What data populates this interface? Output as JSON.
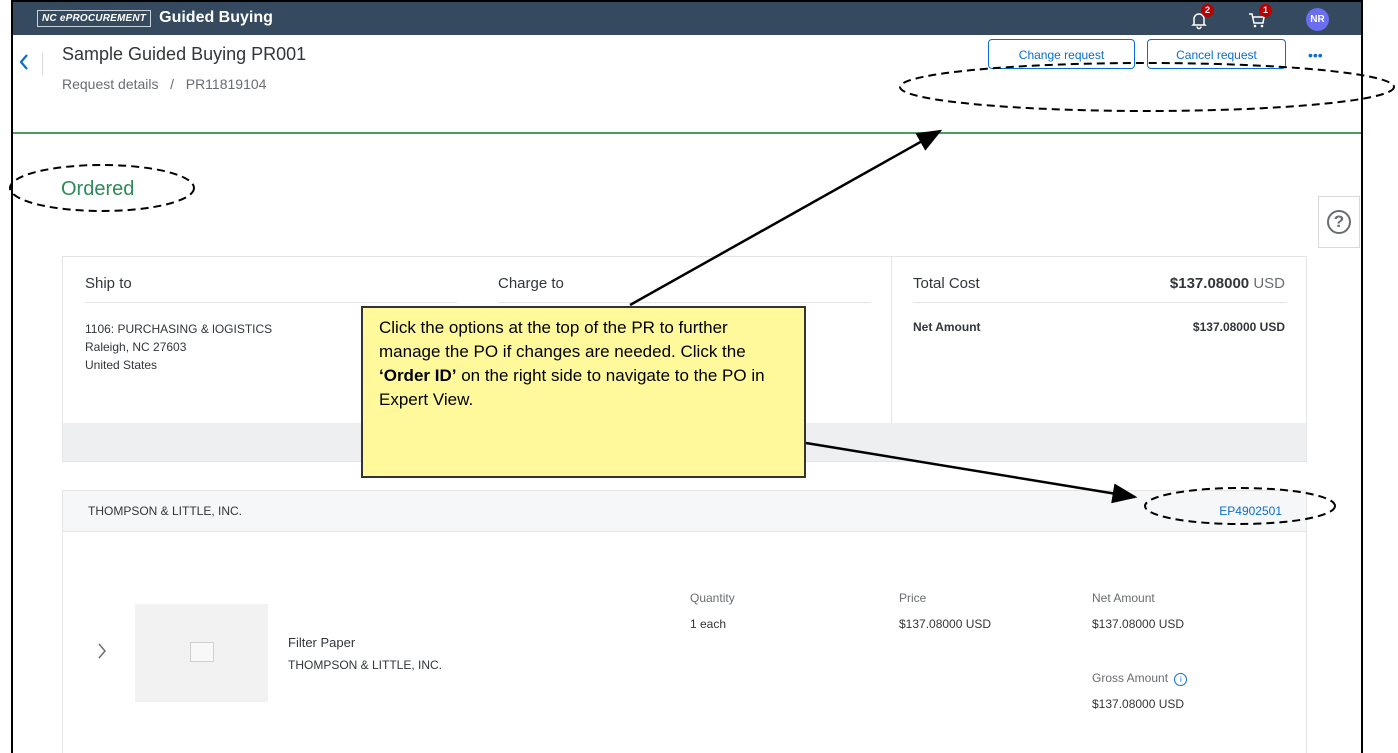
{
  "topbar": {
    "brand_box": "NC ePROCUREMENT",
    "brand_title": "Guided Buying",
    "notifications_count": "2",
    "cart_count": "1",
    "user_initials": "NR"
  },
  "header": {
    "title": "Sample Guided Buying PR001",
    "breadcrumb": "Request details   /   PR11819104",
    "buttons": {
      "change": "Change request",
      "cancel": "Cancel request",
      "more": "•••"
    }
  },
  "status": "Ordered",
  "summary": {
    "ship_to_label": "Ship to",
    "charge_to_label": "Charge to",
    "address_line1": "1106: PURCHASING & lOGISTICS",
    "address_line2": "Raleigh, NC  27603",
    "address_line3": "United States",
    "total_cost_label": "Total Cost",
    "total_cost_value": "$137.08000",
    "total_cost_currency": " USD",
    "net_amount_label": "Net Amount",
    "net_amount_value": "$137.08000 USD"
  },
  "vendor": {
    "name": "THOMPSON & LITTLE, INC.",
    "order_id": "EP4902501"
  },
  "line_item": {
    "name": "Filter Paper",
    "supplier": "THOMPSON & LITTLE, INC.",
    "quantity_label": "Quantity",
    "quantity_value": "1 each",
    "price_label": "Price",
    "price_value": "$137.08000 USD",
    "net_amount_label": "Net Amount",
    "net_amount_value": "$137.08000 USD",
    "gross_amount_label": "Gross Amount",
    "gross_amount_value": "$137.08000 USD"
  },
  "callout": {
    "text_before": "Click the options at the top of the PR to further manage the PO if changes are needed.  Click the ",
    "text_bold": "‘Order ID’",
    "text_after": " on the right side to navigate to the PO in Expert View."
  },
  "colors": {
    "topbar": "#354a5f",
    "accent": "#0a6ed1",
    "status": "#2e8b57",
    "callout": "#fff99b"
  }
}
